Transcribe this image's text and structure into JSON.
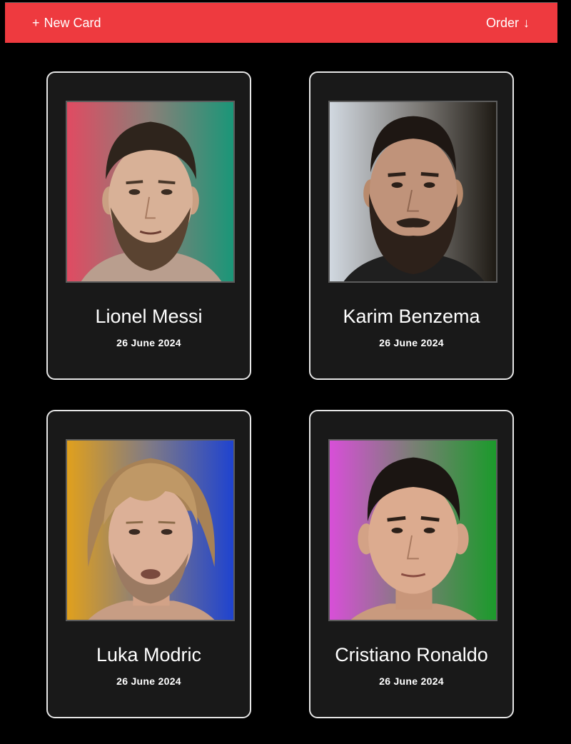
{
  "toolbar": {
    "new_card_label": "New Card",
    "order_label": "Order",
    "plus_glyph": "+",
    "arrow_glyph": "↓",
    "background_color": "#ee3a3f"
  },
  "cards": [
    {
      "name": "Lionel Messi",
      "date": "26 June 2024",
      "gradient": [
        "#e04b62",
        "#1a9678"
      ],
      "photo": "portrait-photo"
    },
    {
      "name": "Karim Benzema",
      "date": "26 June 2024",
      "gradient": [
        "#d1d8e0",
        "#1e1a14"
      ],
      "photo": "portrait-photo"
    },
    {
      "name": "Luka Modric",
      "date": "26 June 2024",
      "gradient": [
        "#e0a01d",
        "#1f43cf"
      ],
      "photo": "portrait-photo"
    },
    {
      "name": "Cristiano Ronaldo",
      "date": "26 June 2024",
      "gradient": [
        "#d84fd8",
        "#1b9a2b"
      ],
      "photo": "portrait-photo"
    }
  ]
}
